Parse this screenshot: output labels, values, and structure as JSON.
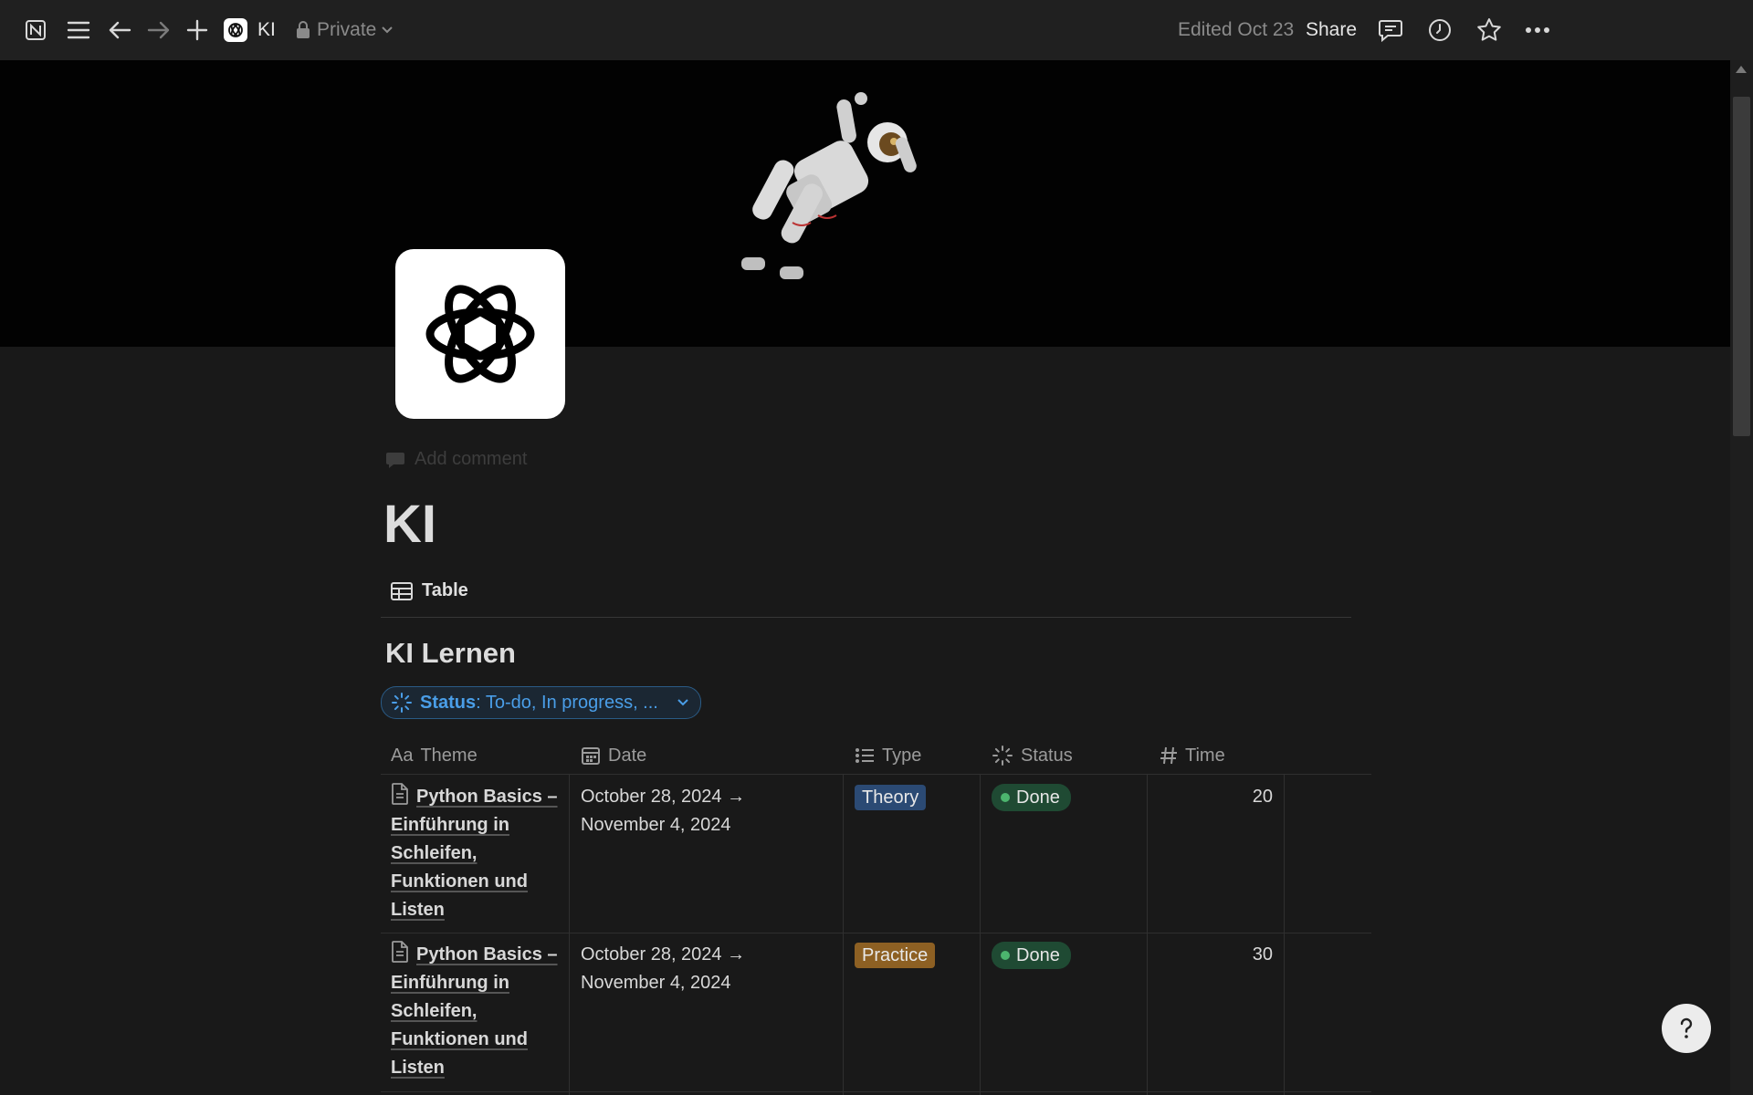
{
  "topbar": {
    "page_name": "KI",
    "privacy": "Private",
    "edited": "Edited Oct 23",
    "share_label": "Share",
    "icons": [
      "notion-logo-icon",
      "menu-icon",
      "back-arrow-icon",
      "forward-arrow-icon",
      "plus-icon",
      "lock-icon",
      "comment-icon",
      "clock-icon",
      "star-icon",
      "more-icon"
    ]
  },
  "page": {
    "add_comment": "Add comment",
    "title": "KI",
    "view_tab": "Table",
    "database_title": "KI Lernen",
    "filter": {
      "property": "Status",
      "value": ": To-do, In progress, ..."
    }
  },
  "table": {
    "columns": [
      {
        "prefix": "Aa",
        "label": "Theme"
      },
      {
        "label": "Date"
      },
      {
        "label": "Type"
      },
      {
        "label": "Status"
      },
      {
        "label": "Time"
      }
    ],
    "rows": [
      {
        "theme": "Python Basics – Einführung in Schleifen, Funktionen und Listen",
        "date_line1": "October 28, 2024 →",
        "date_line2": "November 4, 2024",
        "type": "Theory",
        "status": "Done",
        "time": "20"
      },
      {
        "theme": "Python Basics – Einführung in Schleifen, Funktionen und Listen",
        "date_line1": "October 28, 2024 →",
        "date_line2": "November 4, 2024",
        "type": "Practice",
        "status": "Done",
        "time": "30"
      }
    ]
  },
  "colors": {
    "theory_tag": "#2b4a74",
    "practice_tag": "#8d6023",
    "done_status": "#1f4a33",
    "filter_accent": "#4a9ee8"
  },
  "help_button": "?"
}
